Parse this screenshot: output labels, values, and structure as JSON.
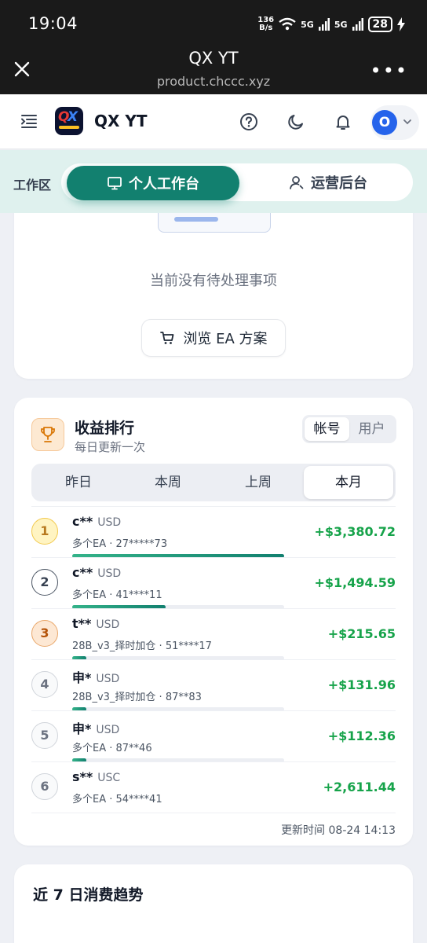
{
  "status": {
    "time": "19:04",
    "net_top": "136",
    "net_bottom": "B/s",
    "sig1": "5G",
    "sig2": "5G",
    "battery": "28"
  },
  "browser": {
    "title": "QX YT",
    "url": "product.chccc.xyz",
    "more": "•••"
  },
  "header": {
    "app_name": "QX YT",
    "avatar_letter": "O"
  },
  "workspace": {
    "label": "工作区",
    "tabs": [
      {
        "label": "个人工作台",
        "active": true
      },
      {
        "label": "运营后台",
        "active": false
      }
    ]
  },
  "todo": {
    "empty_text": "当前没有待处理事项",
    "browse_button": "浏览 EA 方案"
  },
  "ranking": {
    "title": "收益排行",
    "subtitle": "每日更新一次",
    "modes": [
      "帐号",
      "用户"
    ],
    "periods": [
      "昨日",
      "本周",
      "上周",
      "本月"
    ],
    "active_period": "本月",
    "rows": [
      {
        "rank": "1",
        "name": "c**",
        "currency": "USD",
        "account": "多个EA · 27*****73",
        "amount": "+$3,380.72",
        "progress": 1.0
      },
      {
        "rank": "2",
        "name": "c**",
        "currency": "USD",
        "account": "多个EA · 41****11",
        "amount": "+$1,494.59",
        "progress": 0.44
      },
      {
        "rank": "3",
        "name": "t**",
        "currency": "USD",
        "account": "28B_v3_择时加仓 · 51****17",
        "amount": "+$215.65",
        "progress": 0.065
      },
      {
        "rank": "4",
        "name": "申*",
        "currency": "USD",
        "account": "28B_v3_择时加仓 · 87**83",
        "amount": "+$131.96",
        "progress": 0.065
      },
      {
        "rank": "5",
        "name": "申*",
        "currency": "USD",
        "account": "多个EA · 87**46",
        "amount": "+$112.36",
        "progress": 0.065
      },
      {
        "rank": "6",
        "name": "s**",
        "currency": "USC",
        "account": "多个EA · 54****41",
        "amount": "+2,611.44",
        "progress": 0
      }
    ],
    "updated": "更新时间 08-24 14:13"
  },
  "trend": {
    "title": "近 7 日消费趋势"
  }
}
